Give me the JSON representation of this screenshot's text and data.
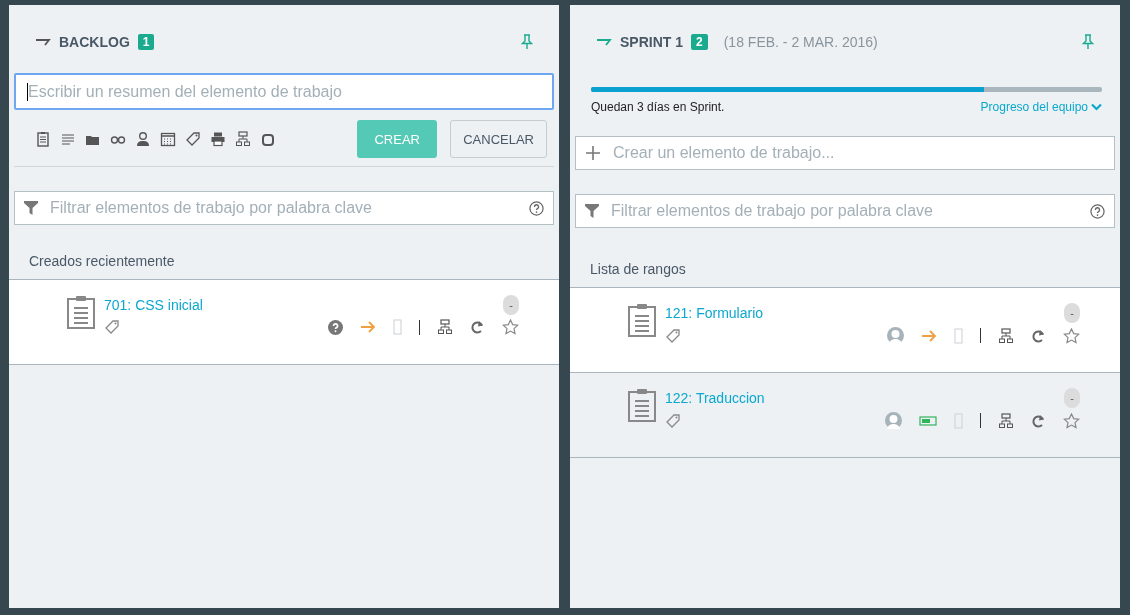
{
  "backlog": {
    "title": "BACKLOG",
    "count": "1",
    "new_item": {
      "placeholder": "Escribir un resumen del elemento de trabajo",
      "focused": true
    },
    "toolbar": [
      {
        "kind": "clipboard"
      },
      {
        "kind": "lines"
      },
      {
        "kind": "folder"
      },
      {
        "kind": "glasses"
      },
      {
        "kind": "person"
      },
      {
        "kind": "calendar"
      },
      {
        "kind": "tag"
      },
      {
        "kind": "printer"
      },
      {
        "kind": "hierarchy"
      },
      {
        "kind": "square"
      }
    ],
    "buttons": [
      {
        "label": "CREAR",
        "kind": "primary"
      },
      {
        "label": "CANCELAR",
        "kind": "secondary"
      }
    ],
    "filter": {
      "placeholder": "Filtrar elementos de trabajo por palabra clave"
    },
    "section": "Creados recientemente",
    "items": [
      {
        "title": "701: CSS inicial",
        "estimate": "-",
        "assignee": {
          "kind": "unknown"
        },
        "status": {
          "kind": "in_progress"
        },
        "highlighted": true
      }
    ]
  },
  "sprint": {
    "title": "SPRINT 1",
    "count": "2",
    "dates": "(18 FEB. - 2 MAR. 2016)",
    "progress": {
      "level": 0.77,
      "remaining": "Quedan 3 días en Sprint.",
      "link": "Progreso del equipo"
    },
    "create": {
      "placeholder": "Crear un elemento de trabajo..."
    },
    "filter": {
      "placeholder": "Filtrar elementos de trabajo por palabra clave"
    },
    "section": "Lista de rangos",
    "items": [
      {
        "title": "121: Formulario",
        "estimate": "-",
        "assignee": {
          "kind": "person"
        },
        "status": {
          "kind": "in_progress"
        },
        "highlighted": true
      },
      {
        "title": "122: Traduccion",
        "estimate": "-",
        "assignee": {
          "kind": "person"
        },
        "status": {
          "kind": "done"
        },
        "highlighted": false
      }
    ]
  }
}
